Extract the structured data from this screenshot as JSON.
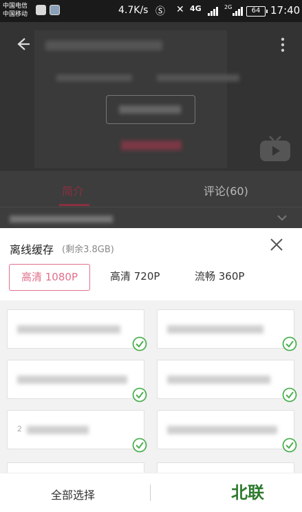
{
  "status_bar": {
    "carrier_1": "中国电信",
    "carrier_2": "中国移动",
    "net_speed": "4.7K/s",
    "network_4g": "4G",
    "network_2g": "2G",
    "battery": "64",
    "time": "17:40"
  },
  "tabs": {
    "intro": "简介",
    "comments": "评论(60)"
  },
  "sheet": {
    "title": "离线缓存",
    "remaining": "(剩余3.8GB)",
    "qualities": [
      "高清 1080P",
      "高清 720P",
      "流畅 360P"
    ],
    "selected_quality": "高清 1080P",
    "episode_numbers": [
      "2"
    ],
    "select_all": "全部选择"
  },
  "watermark": "北联",
  "colors": {
    "accent_pink": "#e0708a",
    "check_green": "#4caf50",
    "watermark_green": "#2e7a2e"
  }
}
